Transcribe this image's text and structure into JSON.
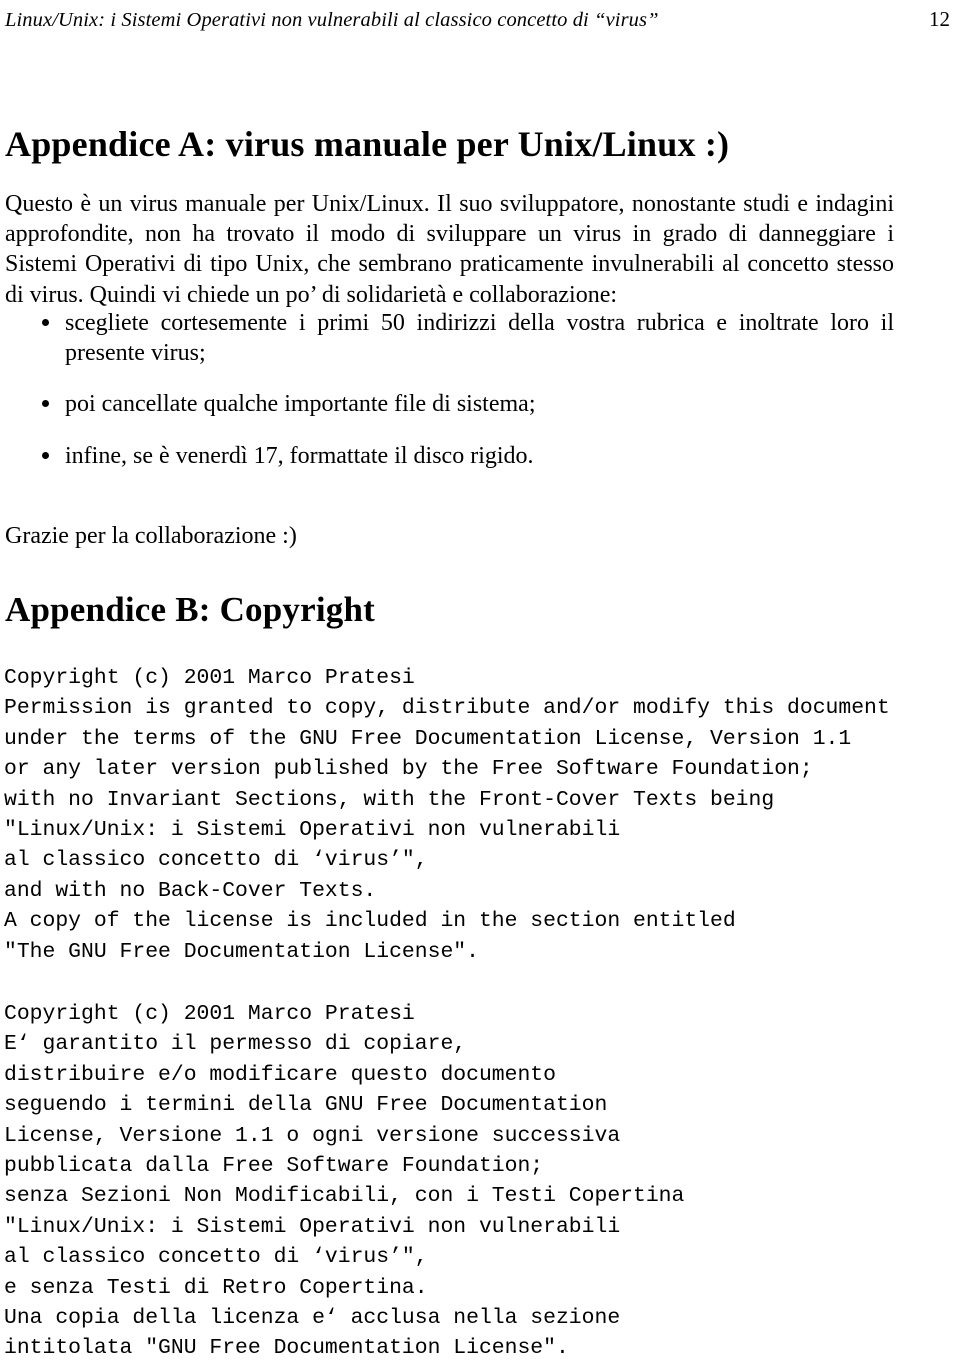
{
  "header": {
    "title": "Linux/Unix: i Sistemi Operativi non vulnerabili al classico concetto di “virus”",
    "page_number": "12"
  },
  "appendix_a": {
    "heading": "Appendice A: virus manuale per Unix/Linux :)",
    "intro": "Questo è un virus manuale per Unix/Linux. Il suo sviluppatore, nonostante studi e indagini approfondite, non ha trovato il modo di sviluppare un virus in grado di danneggiare i Sistemi Operativi di tipo Unix, che sembrano praticamente invulnerabili al concetto stesso di virus. Quindi vi chiede un po’ di solidarietà e collaborazione:",
    "bullets": [
      "scegliete cortesemente i primi 50 indirizzi della vostra rubrica e inoltrate loro il presente virus;",
      "poi cancellate qualche importante file di sistema;",
      "infine, se è venerdì 17, formattate il disco rigido."
    ],
    "thanks": "Grazie per la collaborazione :)"
  },
  "appendix_b": {
    "heading": "Appendice B: Copyright",
    "license_en": [
      "Copyright (c) 2001 Marco Pratesi",
      "Permission is granted to copy, distribute and/or modify this document",
      "under the terms of the GNU Free Documentation License, Version 1.1",
      "or any later version published by the Free Software Foundation;",
      "with no Invariant Sections, with the Front-Cover Texts being",
      "\"Linux/Unix: i Sistemi Operativi non vulnerabili",
      "al classico concetto di ‘virus’\",",
      "and with no Back-Cover Texts.",
      "A copy of the license is included in the section entitled",
      "\"The GNU Free Documentation License\"."
    ],
    "license_it": [
      "Copyright (c) 2001 Marco Pratesi",
      "E‘ garantito il permesso di copiare,",
      "distribuire e/o modificare questo documento",
      "seguendo i termini della GNU Free Documentation",
      "License, Versione 1.1 o ogni versione successiva",
      "pubblicata dalla Free Software Foundation;",
      "senza Sezioni Non Modificabili, con i Testi Copertina",
      "\"Linux/Unix: i Sistemi Operativi non vulnerabili",
      "al classico concetto di ‘virus’\",",
      "e senza Testi di Retro Copertina.",
      "Una copia della licenza e‘ acclusa nella sezione",
      "intitolata \"GNU Free Documentation License\"."
    ]
  }
}
